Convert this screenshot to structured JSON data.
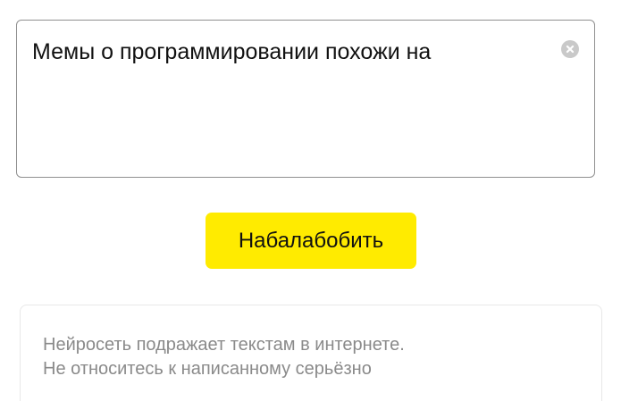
{
  "prompt": {
    "value": "Мемы о программировании похожи на",
    "clear_icon": "clear-circle-icon"
  },
  "actions": {
    "generate_label": "Набалабобить"
  },
  "disclaimer": {
    "lines": [
      "Нейросеть подражает текстам в интернете.",
      "Не относитесь к написанному серьёзно"
    ]
  },
  "colors": {
    "button_background": "#ffeb00",
    "input_border": "#8f8f8f",
    "disclaimer_text": "#8a8a8a",
    "clear_icon_background": "#c9c9c9"
  }
}
